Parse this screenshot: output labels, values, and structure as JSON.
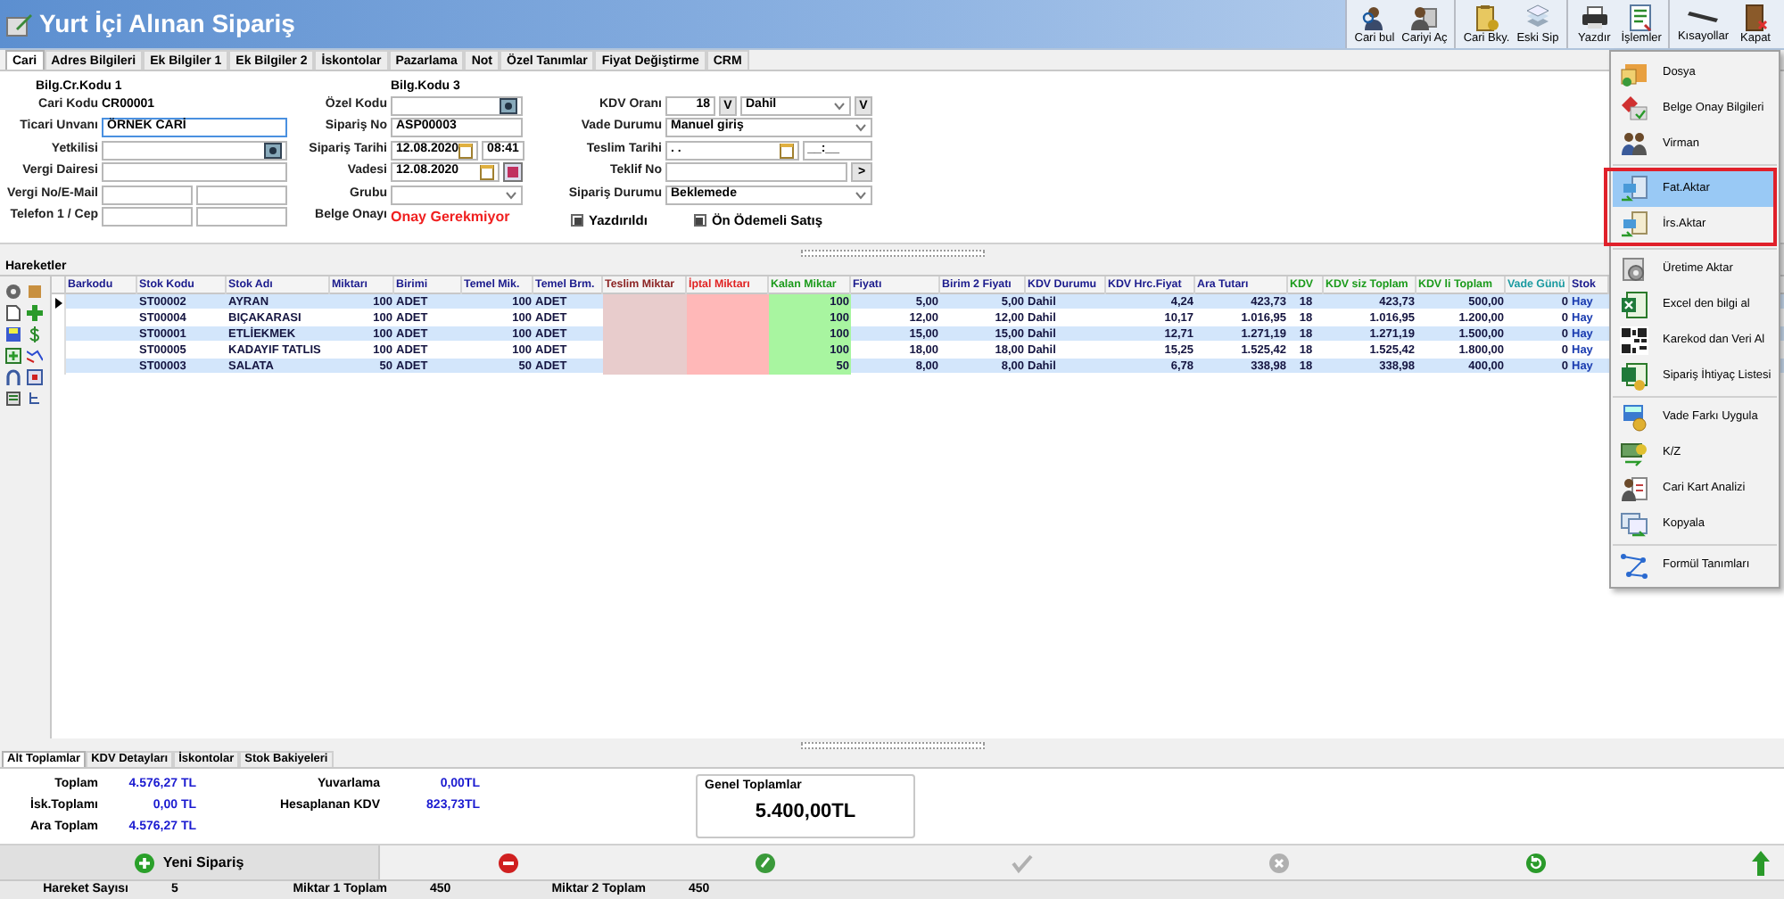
{
  "window": {
    "title": "Yurt İçi Alınan Sipariş"
  },
  "toolbar": {
    "groups": [
      {
        "buttons": [
          {
            "label": "Cari bul",
            "kind": "find"
          },
          {
            "label": "Cariyi Aç",
            "kind": "person"
          }
        ]
      },
      {
        "buttons": [
          {
            "label": "Cari Bky.",
            "kind": "clipboard"
          },
          {
            "label": "Eski Sip",
            "kind": "stack"
          }
        ]
      },
      {
        "buttons": [
          {
            "label": "Yazdır",
            "kind": "printer"
          },
          {
            "label": "İşlemler",
            "kind": "list"
          }
        ]
      },
      {
        "buttons": [
          {
            "label": "Kısayollar",
            "kind": "keyboard"
          },
          {
            "label": "Kapat",
            "kind": "door"
          }
        ]
      }
    ]
  },
  "tabs": [
    {
      "label": "Cari",
      "selected": true
    },
    {
      "label": "Adres Bilgileri",
      "selected": false
    },
    {
      "label": "Ek Bilgiler 1",
      "selected": false
    },
    {
      "label": "Ek Bilgiler 2",
      "selected": false
    },
    {
      "label": "İskontolar",
      "selected": false
    },
    {
      "label": "Pazarlama",
      "selected": false
    },
    {
      "label": "Not",
      "selected": false
    },
    {
      "label": "Özel Tanımlar",
      "selected": false
    },
    {
      "label": "Fiyat Değiştirme",
      "selected": false
    },
    {
      "label": "CRM",
      "selected": false
    }
  ],
  "form": {
    "left": {
      "caption": "Bilg.Cr.Kodu 1",
      "rows": [
        {
          "label": "Cari Kodu",
          "kind": "text",
          "value": "CR00001"
        },
        {
          "label": "Ticari Unvanı",
          "kind": "input",
          "value": "ÖRNEK CARİ",
          "focused": true
        },
        {
          "label": "Yetkilisi",
          "kind": "lookup"
        },
        {
          "label": "Vergi Dairesi",
          "kind": "input",
          "focused": false
        },
        {
          "label": "Vergi No/E-Mail",
          "kind": "pair"
        },
        {
          "label": "Telefon 1 / Cep",
          "kind": "pair"
        }
      ]
    },
    "middle": {
      "caption": "Bilg.Kodu 3",
      "rows": [
        {
          "label": "Özel Kodu",
          "kind": "lookup"
        },
        {
          "label": "Sipariş No",
          "kind": "input",
          "value": "ASP00003",
          "focused": false
        },
        {
          "label": "Sipariş Tarihi",
          "kind": "datetime",
          "value": "12.08.2020",
          "time": "08:41"
        },
        {
          "label": "Vadesi",
          "kind": "date",
          "value": "12.08.2020"
        },
        {
          "label": "Grubu",
          "kind": "select"
        },
        {
          "label": "Belge Onayı",
          "kind": "status",
          "value": "Onay Gerekmiyor"
        }
      ]
    },
    "right": {
      "rows": [
        {
          "label": "KDV Oranı",
          "kind": "rate",
          "value": "18",
          "button": "V",
          "option": "Dahil",
          "button2": "V"
        },
        {
          "label": "Vade Durumu",
          "kind": "select",
          "value": "Manuel giriş"
        },
        {
          "label": "Teslim Tarihi",
          "kind": "datetime",
          "value": ". .",
          "time": "__:__"
        },
        {
          "label": "Teklif No",
          "kind": "action",
          "button": ">"
        },
        {
          "label": "Sipariş Durumu",
          "kind": "select",
          "value": "Beklemede"
        }
      ]
    },
    "checkboxes": [
      {
        "label": "Yazdırıldı",
        "checked": true
      },
      {
        "label": "Ön Ödemeli Satış",
        "checked": true
      }
    ]
  },
  "movements": {
    "title": "Hareketler",
    "columns": [
      {
        "label": "Barkodu",
        "kind": "text",
        "color": "#1a1a8c"
      },
      {
        "label": "Stok Kodu",
        "kind": "text",
        "color": "#1a1a8c"
      },
      {
        "label": "Stok Adı",
        "kind": "text",
        "color": "#1a1a8c"
      },
      {
        "label": "Miktarı",
        "kind": "number",
        "color": "#1a1a8c"
      },
      {
        "label": "Birimi",
        "kind": "text",
        "color": "#1a1a8c"
      },
      {
        "label": "Temel Mik.",
        "kind": "number",
        "color": "#1a1a8c"
      },
      {
        "label": "Temel Brm.",
        "kind": "text",
        "color": "#1a1a8c"
      },
      {
        "label": "Teslim Miktar",
        "kind": "delivered",
        "color": "#8b2323"
      },
      {
        "label": "İptal Miktarı",
        "kind": "cancelled",
        "color": "#e02424"
      },
      {
        "label": "Kalan Miktar",
        "kind": "remaining",
        "color": "#1a9a1a"
      },
      {
        "label": "Fiyatı",
        "kind": "number",
        "color": "#1a1a8c"
      },
      {
        "label": "Birim 2 Fiyatı",
        "kind": "number",
        "color": "#1a1a8c"
      },
      {
        "label": "KDV Durumu",
        "kind": "text",
        "color": "#1a1a8c"
      },
      {
        "label": "KDV Hrc.Fiyat",
        "kind": "number",
        "color": "#1a1a8c"
      },
      {
        "label": "Ara Tutarı",
        "kind": "number",
        "color": "#1a1a8c"
      },
      {
        "label": "KDV",
        "kind": "center",
        "color": "#1a9a1a"
      },
      {
        "label": "KDV siz Toplam",
        "kind": "number",
        "color": "#1a9a1a"
      },
      {
        "label": "KDV li Toplam",
        "kind": "number",
        "color": "#1a9a1a"
      },
      {
        "label": "Vade Günü",
        "kind": "number",
        "color": "#1a9aa0"
      },
      {
        "label": "Stok",
        "kind": "link",
        "color": "#1a1a8c"
      }
    ],
    "rows": [
      {
        "selected": true,
        "cells": [
          "",
          "ST00002",
          "AYRAN",
          "100",
          "ADET",
          "100",
          "ADET",
          "",
          "",
          "100",
          "5,00",
          "5,00",
          "Dahil",
          "4,24",
          "423,73",
          "18",
          "423,73",
          "500,00",
          "0",
          "Hay"
        ]
      },
      {
        "selected": false,
        "cells": [
          "",
          "ST00004",
          "BIÇAKARASI",
          "100",
          "ADET",
          "100",
          "ADET",
          "",
          "",
          "100",
          "12,00",
          "12,00",
          "Dahil",
          "10,17",
          "1.016,95",
          "18",
          "1.016,95",
          "1.200,00",
          "0",
          "Hay"
        ]
      },
      {
        "selected": false,
        "cells": [
          "",
          "ST00001",
          "ETLİEKMEK",
          "100",
          "ADET",
          "100",
          "ADET",
          "",
          "",
          "100",
          "15,00",
          "15,00",
          "Dahil",
          "12,71",
          "1.271,19",
          "18",
          "1.271,19",
          "1.500,00",
          "0",
          "Hay"
        ]
      },
      {
        "selected": false,
        "cells": [
          "",
          "ST00005",
          "KADAYIF TATLIS",
          "100",
          "ADET",
          "100",
          "ADET",
          "",
          "",
          "100",
          "18,00",
          "18,00",
          "Dahil",
          "15,25",
          "1.525,42",
          "18",
          "1.525,42",
          "1.800,00",
          "0",
          "Hay"
        ]
      },
      {
        "selected": false,
        "cells": [
          "",
          "ST00003",
          "SALATA",
          "50",
          "ADET",
          "50",
          "ADET",
          "",
          "",
          "50",
          "8,00",
          "8,00",
          "Dahil",
          "6,78",
          "338,98",
          "18",
          "338,98",
          "400,00",
          "0",
          "Hay"
        ]
      }
    ]
  },
  "menu": {
    "groups": [
      {
        "highlighted": false,
        "items": [
          {
            "label": "Dosya",
            "selected": false
          },
          {
            "label": "Belge Onay Bilgileri",
            "selected": false
          },
          {
            "label": "Virman",
            "selected": false
          }
        ]
      },
      {
        "highlighted": true,
        "items": [
          {
            "label": "Fat.Aktar",
            "selected": true
          },
          {
            "label": "İrs.Aktar",
            "selected": false
          }
        ]
      },
      {
        "highlighted": false,
        "items": [
          {
            "label": "Üretime Aktar",
            "selected": false
          },
          {
            "label": "Excel den bilgi al",
            "selected": false
          },
          {
            "label": "Karekod dan Veri Al",
            "selected": false
          },
          {
            "label": "Sipariş İhtiyaç Listesi",
            "selected": false
          }
        ]
      },
      {
        "highlighted": false,
        "items": [
          {
            "label": "Vade Farkı Uygula",
            "selected": false
          },
          {
            "label": "K/Z",
            "selected": false
          },
          {
            "label": "Cari Kart Analizi",
            "selected": false
          },
          {
            "label": "Kopyala",
            "selected": false
          }
        ]
      },
      {
        "highlighted": false,
        "items": [
          {
            "label": "Formül Tanımları",
            "selected": false
          }
        ]
      }
    ]
  },
  "bottom_tabs": [
    {
      "label": "Alt Toplamlar",
      "selected": true
    },
    {
      "label": "KDV Detayları",
      "selected": false
    },
    {
      "label": "İskontolar",
      "selected": false
    },
    {
      "label": "Stok Bakiyeleri",
      "selected": false
    }
  ],
  "totals": {
    "left": [
      {
        "label": "Toplam",
        "value": "4.576,27 TL"
      },
      {
        "label": "İsk.Toplamı",
        "value": "0,00 TL"
      },
      {
        "label": "Ara Toplam",
        "value": "4.576,27 TL"
      }
    ],
    "middle": [
      {
        "label": "Yuvarlama",
        "value": "0,00TL"
      },
      {
        "label": "Hesaplanan KDV",
        "value": "823,73TL"
      }
    ],
    "grand": {
      "title": "Genel Toplamlar",
      "value": "5.400,00TL"
    }
  },
  "actions": [
    {
      "kind": "new",
      "label": "Yeni Sipariş",
      "disabled": false
    },
    {
      "kind": "delete",
      "disabled": false
    },
    {
      "kind": "edit",
      "disabled": false
    },
    {
      "kind": "confirm",
      "disabled": true
    },
    {
      "kind": "cancel",
      "disabled": true
    },
    {
      "kind": "refresh",
      "disabled": false
    },
    {
      "kind": "up",
      "disabled": false
    }
  ],
  "status_bar": [
    {
      "label": "Hareket Sayısı",
      "value": "5"
    },
    {
      "label": "Miktar 1 Toplam",
      "value": "450"
    },
    {
      "label": "Miktar 2 Toplam",
      "value": "450"
    }
  ]
}
